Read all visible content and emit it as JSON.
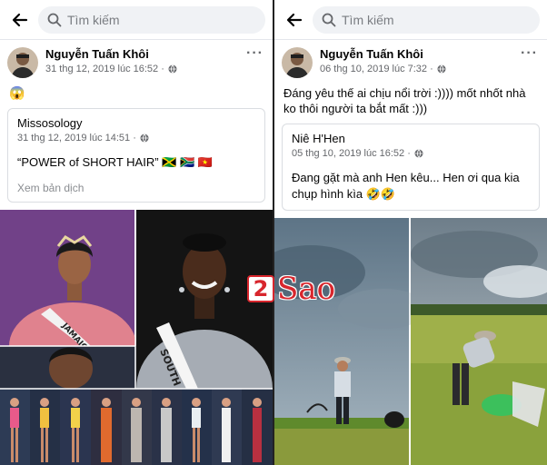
{
  "search": {
    "placeholder": "Tìm kiếm"
  },
  "left": {
    "author": "Nguyễn Tuấn Khôi",
    "timestamp": "31 thg 12, 2019 lúc 16:52 ·",
    "post_text": "😱",
    "shared": {
      "author": "Missosology",
      "timestamp": "31 thg 12, 2019 lúc 14:51 ·",
      "text": "“POWER of SHORT HAIR” 🇯🇲 🇿🇦 🇻🇳",
      "translate": "Xem bản dịch"
    },
    "sash1": "JAMAICA",
    "sash2": "SOUTH"
  },
  "right": {
    "author": "Nguyễn Tuấn Khôi",
    "timestamp": "06 thg 10, 2019 lúc 7:32 ·",
    "post_text": "Đáng yêu thế ai chịu nổi trời :)))) mốt nhốt nhà ko thôi người ta bắt mất :)))",
    "shared": {
      "author": "Niê H'Hen",
      "timestamp": "05 thg 10, 2019 lúc 16:52 ·",
      "text": "Đang gặt mà anh Hen kêu... Hen ơi qua kia chụp hình kìa 🤣🤣"
    }
  },
  "watermark": {
    "digit": "2",
    "word": "Sao"
  },
  "colors": {
    "accent": "#1877f2",
    "watermark_red": "#d8262d"
  }
}
